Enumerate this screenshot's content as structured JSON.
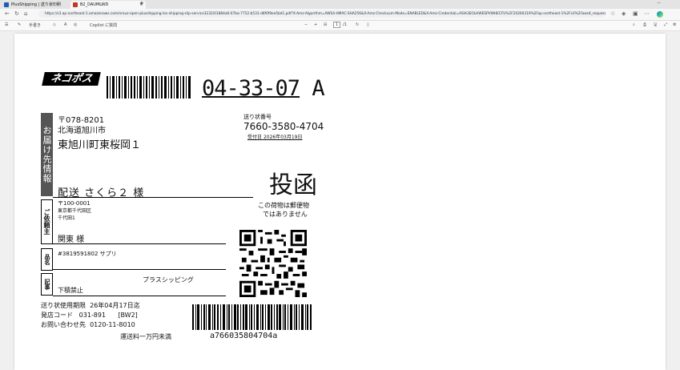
{
  "browser": {
    "tabs": [
      {
        "title": "PlusShipping | 送り状印刷",
        "color": "#1a5fb4"
      },
      {
        "title": "B2_DAUMLWD",
        "color": "#c0392b"
      }
    ],
    "new_tab": "+",
    "url": "https://s3.ap-northeast-1.amazonaws.com/nrouz-open-plusshipping-les-shipping-slip-service3232/01884a6-07ba-7752-b531-d8f0f9ee5bd1.pdf?X-Amz-Algorithm=AWS4-HMAC-SHA256&X-Amz-Checksum-Mode=ENABLED&X-Amz-Credential=ASIA3EOLHWESPVWHECFU%2F20260319%2Fap-northeast-1%2Fs3%2Faws4_request&X-..."
  },
  "pdf_toolbar": {
    "draw": "手書き",
    "copilot": "Copilot に質問",
    "zoom_minus": "−",
    "zoom_plus": "+",
    "page_current": "1",
    "page_total": "/1"
  },
  "label": {
    "brand": "ネコポス",
    "sort_code_a": "04-33-07",
    "sort_code_b": "A",
    "to_label": "お届け先情報",
    "to_zip": "〒078-8201",
    "to_addr1": "北海道旭川市",
    "to_addr2": "東旭川町東桜岡１",
    "to_name": "配送 さくら２ 様",
    "tracking_label": "送り状番号",
    "tracking_number": "7660-3580-4704",
    "received_label": "受付日",
    "received_date": "2026年03月19日",
    "mailbox": "投函",
    "notice1": "この荷物は郵便物",
    "notice2": "ではありません",
    "from_label": "ご依頼主",
    "from_zip": "〒100-0001",
    "from_addr1": "東京都千代田区",
    "from_addr2": "千代田1",
    "from_name": "関東 様",
    "item_label": "品名",
    "item_value": "#3819591802 サプリ",
    "note_label": "記事",
    "note_company": "プラスシッピング",
    "note_value": "下積禁止",
    "valid_label": "送り状使用期限",
    "valid_value": "26年04月17日迄",
    "office_label": "発店コード",
    "office_code": "031-891",
    "office_mark": "[BW2]",
    "contact_label": "お問い合わせ先",
    "contact_number": "0120-11-8010",
    "insurance": "運送料一万円未満",
    "barcode_text": "a766035804704a"
  }
}
